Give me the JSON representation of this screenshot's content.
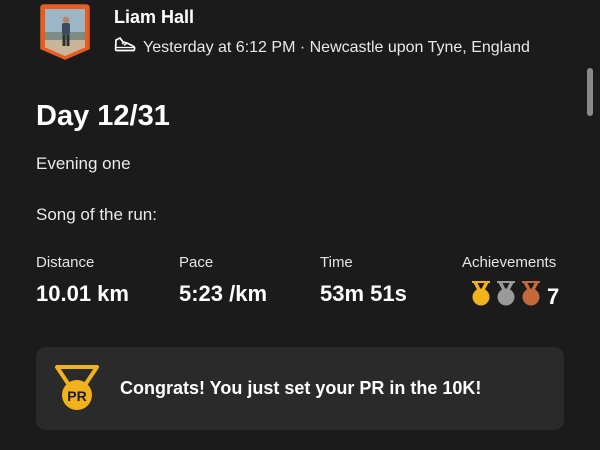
{
  "header": {
    "user_name": "Liam Hall",
    "timestamp_location": "Yesterday at 6:12 PM · Newcastle upon Tyne, England",
    "activity_icon": "shoe-icon"
  },
  "activity": {
    "title": "Day 12/31",
    "description_line1": "Evening one",
    "description_line2": "Song of the run:"
  },
  "stats": {
    "distance": {
      "label": "Distance",
      "value": "10.01 km"
    },
    "pace": {
      "label": "Pace",
      "value": "5:23 /km"
    },
    "time": {
      "label": "Time",
      "value": "53m 51s"
    },
    "achievements": {
      "label": "Achievements",
      "count": "7",
      "medal_icons": [
        "gold-medal-icon",
        "silver-medal-icon",
        "bronze-medal-icon"
      ]
    }
  },
  "pr_banner": {
    "icon": "pr-medal-icon",
    "icon_text": "PR",
    "message": "Congrats! You just set your PR in the 10K!"
  },
  "colors": {
    "background": "#1c1b1b",
    "card": "#2b2a2a",
    "brand_orange": "#e85d1f",
    "gold": "#f2b21b",
    "silver": "#9a9a9a",
    "bronze": "#c4693a"
  }
}
